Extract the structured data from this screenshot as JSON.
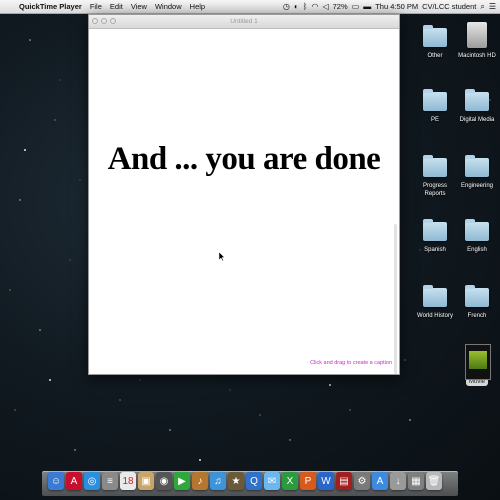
{
  "menubar": {
    "app_name": "QuickTime Player",
    "menus": [
      "File",
      "Edit",
      "View",
      "Window",
      "Help"
    ],
    "battery": "72%",
    "clock": "Thu 4:50 PM",
    "user": "CV/LCC student"
  },
  "window": {
    "title": "Untitled 1",
    "headline": "And ... you are done",
    "caption_hint": "Click and drag to create a caption"
  },
  "desktop": {
    "icons": [
      {
        "label": "Other",
        "type": "folder"
      },
      {
        "label": "Macintosh HD",
        "type": "drive"
      },
      {
        "label": "PE",
        "type": "folder"
      },
      {
        "label": "Digital Media",
        "type": "folder"
      },
      {
        "label": "Progress Reports",
        "type": "folder"
      },
      {
        "label": "Engineering",
        "type": "folder"
      },
      {
        "label": "Spanish",
        "type": "folder"
      },
      {
        "label": "English",
        "type": "folder"
      },
      {
        "label": "World History",
        "type": "folder"
      },
      {
        "label": "French",
        "type": "folder"
      },
      {
        "label": "Movie",
        "type": "movie"
      }
    ]
  },
  "dock": {
    "apps": [
      {
        "name": "finder-icon",
        "glyph": "☺",
        "color": "#3a7bd5"
      },
      {
        "name": "adobe-reader-icon",
        "glyph": "A",
        "color": "#c8102e"
      },
      {
        "name": "safari-icon",
        "glyph": "◎",
        "color": "#2b8fe0"
      },
      {
        "name": "notes-icon",
        "glyph": "≡",
        "color": "#8a8a8a"
      },
      {
        "name": "calendar-icon",
        "glyph": "18",
        "color": "#e9e9e9"
      },
      {
        "name": "preview-icon",
        "glyph": "▣",
        "color": "#caa56a"
      },
      {
        "name": "photo-booth-icon",
        "glyph": "◉",
        "color": "#555"
      },
      {
        "name": "facetime-icon",
        "glyph": "▶",
        "color": "#2fa83b"
      },
      {
        "name": "garageband-icon",
        "glyph": "♪",
        "color": "#b5772f"
      },
      {
        "name": "itunes-icon",
        "glyph": "♫",
        "color": "#3e94d8"
      },
      {
        "name": "imovie-icon",
        "glyph": "★",
        "color": "#6a5a3a"
      },
      {
        "name": "quicktime-icon",
        "glyph": "Q",
        "color": "#3071c9"
      },
      {
        "name": "messages-icon",
        "glyph": "✉",
        "color": "#6bb7ef"
      },
      {
        "name": "excel-icon",
        "glyph": "X",
        "color": "#2e9a3e"
      },
      {
        "name": "powerpoint-icon",
        "glyph": "P",
        "color": "#d65a1b"
      },
      {
        "name": "word-icon",
        "glyph": "W",
        "color": "#2a66c9"
      },
      {
        "name": "photo-icon",
        "glyph": "▤",
        "color": "#a02020"
      },
      {
        "name": "system-preferences-icon",
        "glyph": "⚙",
        "color": "#7a7a7a"
      },
      {
        "name": "app-store-icon",
        "glyph": "A",
        "color": "#3c8be0"
      },
      {
        "name": "downloads-icon",
        "glyph": "↓",
        "color": "#9a9a9a"
      },
      {
        "name": "documents-icon",
        "glyph": "▦",
        "color": "#7f7f7f"
      },
      {
        "name": "trash-icon",
        "glyph": "🗑",
        "color": "#b8b8b8"
      }
    ]
  }
}
